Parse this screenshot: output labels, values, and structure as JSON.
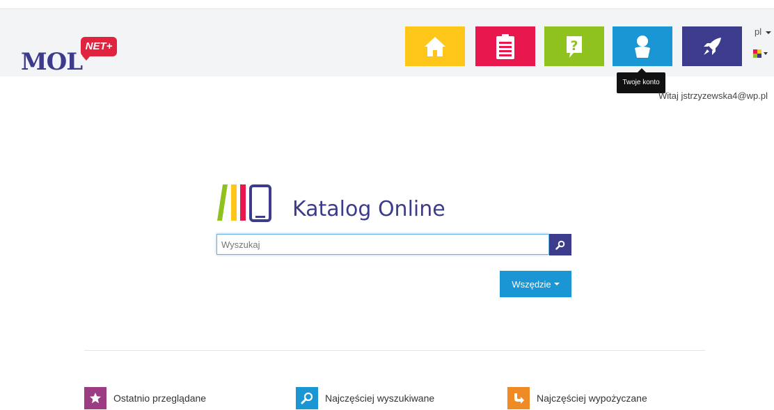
{
  "header": {
    "logo_text": "MOL",
    "logo_badge": "NET+",
    "tiles": [
      {
        "icon": "home-icon",
        "color": "#ffc61a"
      },
      {
        "icon": "clipboard-icon",
        "color": "#e8174d"
      },
      {
        "icon": "question-icon",
        "color": "#8fc21f"
      },
      {
        "icon": "user-icon",
        "color": "#1a96d4"
      },
      {
        "icon": "rocket-icon",
        "color": "#3c3b8c"
      }
    ],
    "language": "pl",
    "tooltip": "Twoje konto",
    "welcome": "Witaj jstrzyzewska4@wp.pl"
  },
  "catalog": {
    "title": "Katalog Online",
    "search_placeholder": "Wyszukaj",
    "scope_label": "Wszędzie"
  },
  "bottom_links": [
    {
      "label": "Ostatnio przeglądane",
      "icon": "star-icon",
      "color": "#9c3d83"
    },
    {
      "label": "Najczęściej wyszukiwane",
      "icon": "search-icon",
      "color": "#1a96d4"
    },
    {
      "label": "Najczęściej wypożyczane",
      "icon": "return-arrow-icon",
      "color": "#f08a24"
    }
  ]
}
